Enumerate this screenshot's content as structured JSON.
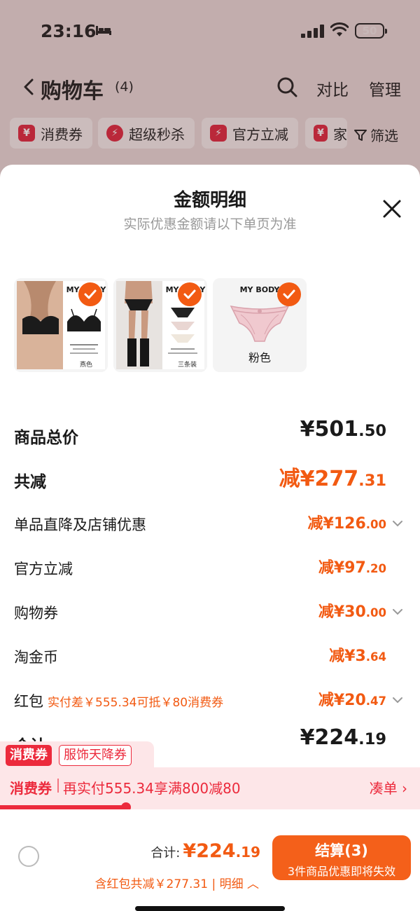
{
  "status_bar": {
    "time": "23:16",
    "battery": "50"
  },
  "nav": {
    "title": "购物车",
    "count": "(4)",
    "compare": "对比",
    "manage": "管理"
  },
  "filter_chips": [
    {
      "icon": "¥",
      "label": "消费券"
    },
    {
      "icon": "⚡",
      "label": "超级秒杀"
    },
    {
      "icon": "⚡",
      "label": "官方立减"
    },
    {
      "icon": "¥",
      "label": "家"
    }
  ],
  "filter_label": "筛选",
  "sheet": {
    "title": "金额明细",
    "subtitle": "实际优惠金额请以下单页为准",
    "products": [
      {
        "brand": "MY BODY",
        "caption": "",
        "mini": "燕色"
      },
      {
        "brand": "MY BODY",
        "caption": "",
        "mini": "三条装"
      },
      {
        "brand": "MY BODY",
        "caption": "粉色",
        "mini": ""
      }
    ],
    "rows": [
      {
        "label": "商品总价",
        "prefix": "¥",
        "int": "501",
        "cents": ".50",
        "style": "total"
      },
      {
        "label": "共减",
        "prefix": "减¥",
        "int": "277",
        "cents": ".31",
        "style": "discount_total"
      },
      {
        "label": "单品直降及店铺优惠",
        "prefix": "减¥",
        "int": "126",
        "cents": ".00",
        "expand": true
      },
      {
        "label": "官方立减",
        "prefix": "减¥",
        "int": "97",
        "cents": ".20",
        "expand": false
      },
      {
        "label": "购物券",
        "prefix": "减¥",
        "int": "30",
        "cents": ".00",
        "expand": true
      },
      {
        "label": "淘金币",
        "prefix": "减¥",
        "int": "3",
        "cents": ".64",
        "expand": false
      },
      {
        "label": "红包",
        "note": "实付差￥555.34可抵￥80消费券",
        "prefix": "减¥",
        "int": "20",
        "cents": ".47",
        "expand": true
      },
      {
        "label": "合计",
        "prefix": "¥",
        "int": "224",
        "cents": ".19",
        "style": "total"
      }
    ]
  },
  "coupon": {
    "tag1": "消费券",
    "tag2": "服饰天降券",
    "name": "消费券",
    "message": "再实付555.34享满800减80",
    "link": "凑单 ›",
    "progress": 0.3
  },
  "bottom": {
    "total_label": "合计:",
    "total_prefix": "¥",
    "total_int": "224",
    "total_cents": ".19",
    "detail": "含红包共减￥277.31 | 明细 ︿",
    "checkout_label": "结算(3)",
    "checkout_sub": "3件商品优惠即将失效"
  },
  "colors": {
    "accent": "#f25a12",
    "red": "#ec2a3c"
  }
}
